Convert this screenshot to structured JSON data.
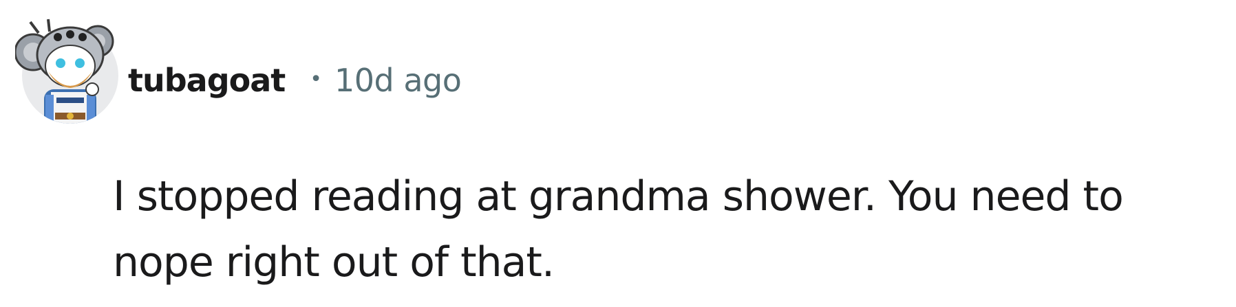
{
  "comment": {
    "author": "tubagoat",
    "separator": "•",
    "timestamp": "10d ago",
    "avatar_icon": "koala-snoo-avatar-icon",
    "body": "I stopped reading at grandma shower. You need to nope right out of that."
  },
  "colors": {
    "text_primary": "#1a1a1b",
    "text_meta": "#576f76",
    "background": "#ffffff"
  }
}
